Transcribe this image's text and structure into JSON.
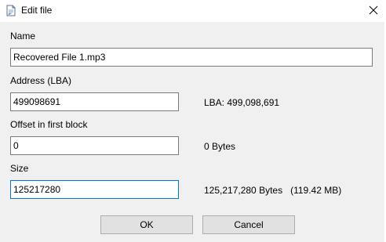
{
  "window": {
    "title": "Edit file",
    "icon": "edit-file-icon",
    "close_icon": "close-icon"
  },
  "form": {
    "name": {
      "label": "Name",
      "value": "Recovered File 1.mp3"
    },
    "address": {
      "label": "Address (LBA)",
      "value": "499098691",
      "info": "LBA: 499,098,691"
    },
    "offset": {
      "label": "Offset in first block",
      "value": "0",
      "info": "0 Bytes"
    },
    "size": {
      "label": "Size",
      "value": "125217280",
      "info": "125,217,280 Bytes   (119.42 MB)"
    }
  },
  "buttons": {
    "ok": "OK",
    "cancel": "Cancel"
  },
  "colors": {
    "focus_border": "#0078d7",
    "window_bg": "#f0f0f0",
    "button_bg": "#e1e1e1"
  }
}
